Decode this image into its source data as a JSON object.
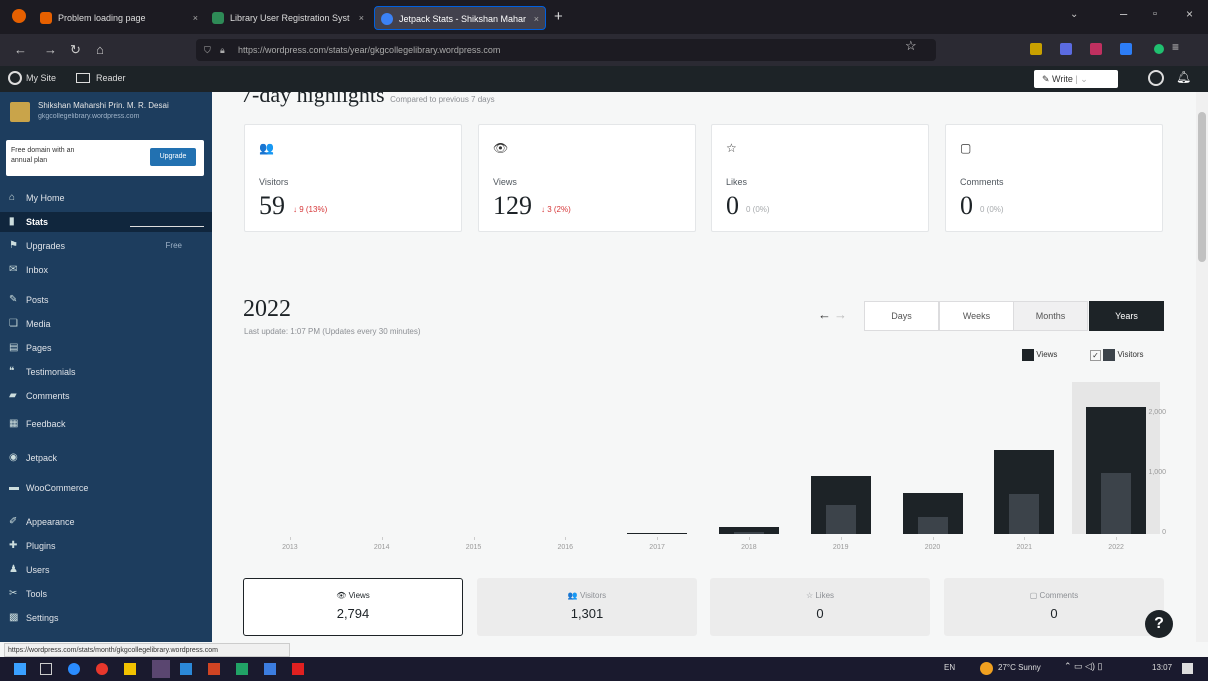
{
  "browser": {
    "tabs": [
      {
        "label": "Problem loading page",
        "color": "#e66000"
      },
      {
        "label": "Library User Registration Syst",
        "color": "#2e8b57"
      },
      {
        "label": "Jetpack Stats - Shikshan Mahar",
        "color": "#3b82f6"
      }
    ],
    "url": "https://wordpress.com/stats/year/gkgcollegelibrary.wordpress.com"
  },
  "wpbar": {
    "my_site": "My Site",
    "reader": "Reader",
    "write": "Write"
  },
  "site": {
    "name": "Shikshan Maharshi Prin. M. R. Desai",
    "url": "gkgcollegelibrary.wordpress.com"
  },
  "upgrade_box": {
    "text": "Free domain with an annual plan",
    "button": "Upgrade"
  },
  "sidebar": [
    {
      "label": "My Home",
      "icon": "⌂"
    },
    {
      "label": "Stats",
      "icon": "▮"
    },
    {
      "label": "Upgrades",
      "icon": "⚑",
      "badge": "Free"
    },
    {
      "label": "Inbox",
      "icon": "✉"
    },
    {
      "label": "Posts",
      "icon": "✎"
    },
    {
      "label": "Media",
      "icon": "❏"
    },
    {
      "label": "Pages",
      "icon": "▤"
    },
    {
      "label": "Testimonials",
      "icon": "❝"
    },
    {
      "label": "Comments",
      "icon": "▰"
    },
    {
      "label": "Feedback",
      "icon": "▦"
    },
    {
      "label": "Jetpack",
      "icon": "◉"
    },
    {
      "label": "WooCommerce",
      "icon": "▬"
    },
    {
      "label": "Appearance",
      "icon": "✐"
    },
    {
      "label": "Plugins",
      "icon": "✚"
    },
    {
      "label": "Users",
      "icon": "♟"
    },
    {
      "label": "Tools",
      "icon": "✂"
    },
    {
      "label": "Settings",
      "icon": "▩"
    }
  ],
  "highlights": {
    "title": "7-day highlights",
    "subtitle": "Compared to previous 7 days",
    "cards": [
      {
        "label": "Visitors",
        "value": "59",
        "change": "↓ 9 (13%)",
        "icon": "👥"
      },
      {
        "label": "Views",
        "value": "129",
        "change": "↓ 3 (2%)",
        "icon": "👁"
      },
      {
        "label": "Likes",
        "value": "0",
        "change": "0 (0%)",
        "icon": "☆"
      },
      {
        "label": "Comments",
        "value": "0",
        "change": "0 (0%)",
        "icon": "▢"
      }
    ]
  },
  "period": {
    "title": "2022",
    "updated": "Last update: 1:07 PM (Updates every 30 minutes)",
    "segments": [
      "Days",
      "Weeks",
      "Months",
      "Years"
    ],
    "selected": "Years"
  },
  "legend": {
    "views": "Views",
    "visitors": "Visitors"
  },
  "chart_data": {
    "type": "bar",
    "categories": [
      "2013",
      "2014",
      "2015",
      "2016",
      "2017",
      "2018",
      "2019",
      "2020",
      "2021",
      "2022"
    ],
    "series": [
      {
        "name": "Views",
        "values": [
          0,
          0,
          0,
          0,
          15,
          120,
          960,
          680,
          1400,
          2120
        ]
      },
      {
        "name": "Visitors",
        "values": [
          0,
          0,
          0,
          0,
          5,
          40,
          480,
          280,
          660,
          1010
        ]
      }
    ],
    "yticks": [
      "2,000",
      "1,000",
      "0"
    ],
    "ylim": [
      0,
      2400
    ],
    "highlight": "2022"
  },
  "stats": [
    {
      "label": "Views",
      "value": "2,794",
      "icon": "👁"
    },
    {
      "label": "Visitors",
      "value": "1,301",
      "icon": "👥"
    },
    {
      "label": "Likes",
      "value": "0",
      "icon": "☆"
    },
    {
      "label": "Comments",
      "value": "0",
      "icon": "▢"
    }
  ],
  "status_url": "https://wordpress.com/stats/month/gkgcollegelibrary.wordpress.com",
  "taskbar": {
    "weather": "27°C Sunny",
    "lang": "EN",
    "time": "13:07"
  }
}
